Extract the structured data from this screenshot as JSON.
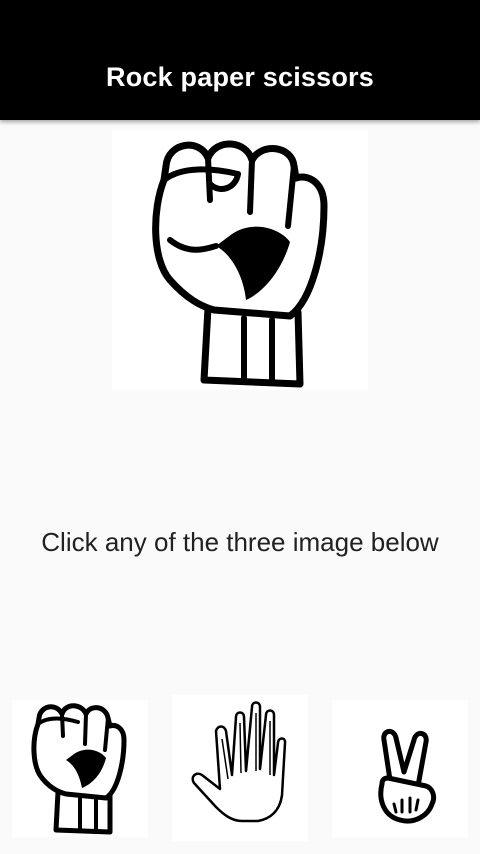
{
  "appbar": {
    "title": "Rock paper scissors",
    "background": "#000000",
    "title_color": "#ffffff"
  },
  "main": {
    "selected_icon": "rock-fist-icon",
    "instruction": "Click any of the three image below"
  },
  "choices": [
    {
      "id": "rock",
      "icon": "rock-fist-icon"
    },
    {
      "id": "paper",
      "icon": "paper-hand-icon"
    },
    {
      "id": "scissors",
      "icon": "scissors-hand-icon"
    }
  ]
}
